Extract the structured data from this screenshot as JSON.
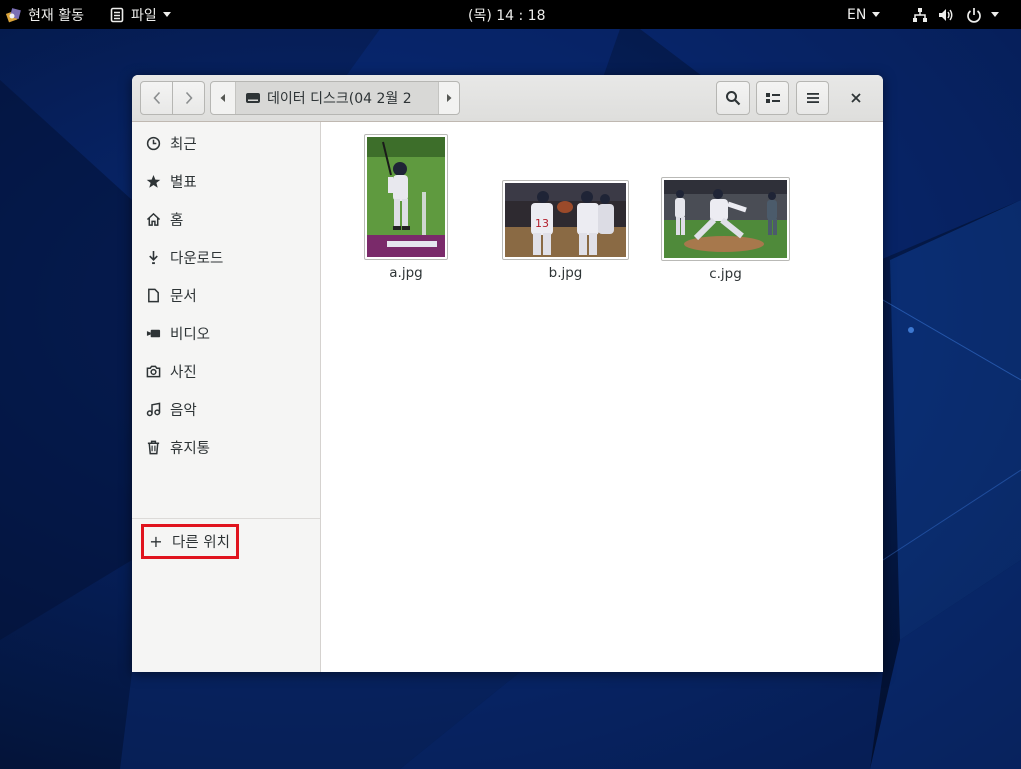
{
  "topbar": {
    "activities_label": "현재 활동",
    "app_menu_label": "파일",
    "clock": "(목) 14 : 18",
    "input_language": "EN"
  },
  "window": {
    "path_current_label": "데이터 디스크(04  2월 2",
    "sidebar": {
      "items": [
        {
          "label": "최근",
          "icon": "clock-icon"
        },
        {
          "label": "별표",
          "icon": "star-icon"
        },
        {
          "label": "홈",
          "icon": "home-icon"
        },
        {
          "label": "다운로드",
          "icon": "download-icon"
        },
        {
          "label": "문서",
          "icon": "document-icon"
        },
        {
          "label": "비디오",
          "icon": "video-icon"
        },
        {
          "label": "사진",
          "icon": "camera-icon"
        },
        {
          "label": "음악",
          "icon": "music-icon"
        },
        {
          "label": "휴지통",
          "icon": "trash-icon"
        }
      ],
      "other_locations_label": "다른 위치",
      "other_locations_icon": "+"
    },
    "files": [
      {
        "name": "a.jpg"
      },
      {
        "name": "b.jpg"
      },
      {
        "name": "c.jpg"
      }
    ]
  },
  "colors": {
    "topbar_bg": "#000000",
    "highlight_box": "#e0141e",
    "sidebar_bg": "#f5f5f4",
    "headerbar_bg": "#e0e0de"
  }
}
